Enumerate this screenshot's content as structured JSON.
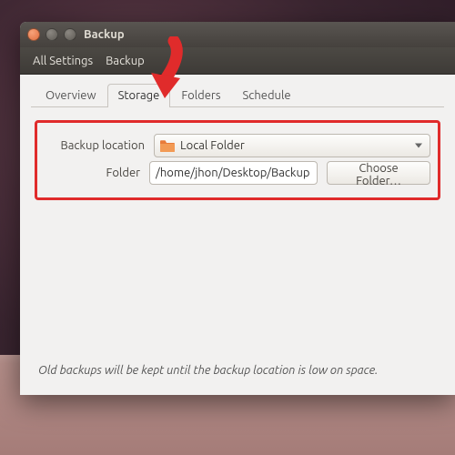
{
  "window": {
    "title": "Backup",
    "toolbar": {
      "all_settings": "All Settings",
      "section": "Backup"
    },
    "tabs": [
      {
        "label": "Overview"
      },
      {
        "label": "Storage"
      },
      {
        "label": "Folders"
      },
      {
        "label": "Schedule"
      }
    ],
    "active_tab_index": 1,
    "storage": {
      "location_label": "Backup location",
      "location_value": "Local Folder",
      "folder_label": "Folder",
      "folder_value": "/home/jhon/Desktop/Backup",
      "choose_button": "Choose Folder…"
    },
    "footer": "Old backups will be kept until the backup location is low on space."
  },
  "annotation": {
    "arrow_color": "#e02b2b",
    "highlight_color": "#e02b2b"
  }
}
